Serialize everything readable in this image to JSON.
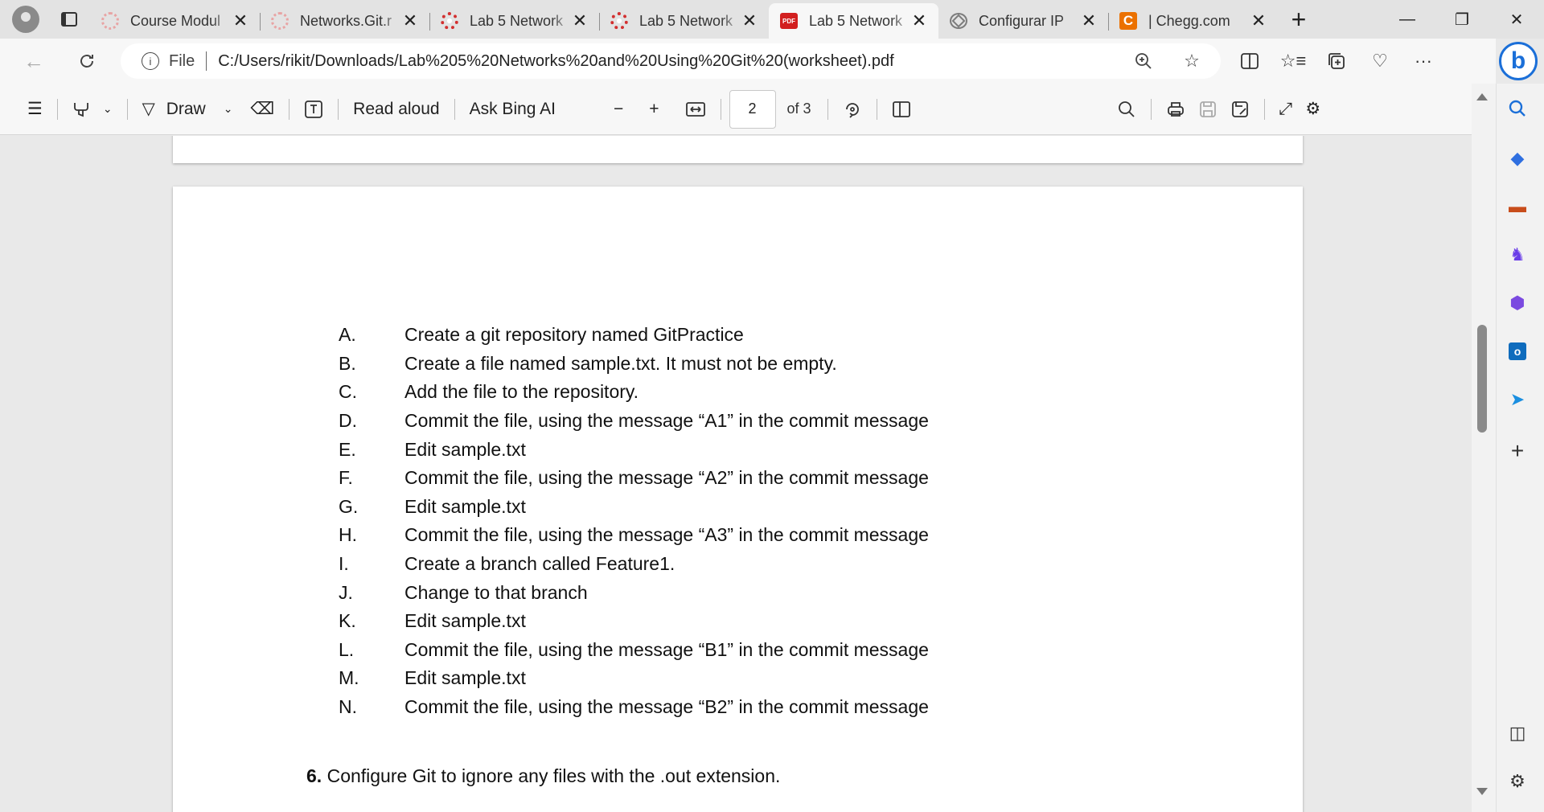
{
  "tabs": [
    {
      "title": "Course Modul",
      "favicon": "pale-logo-icon",
      "active": false
    },
    {
      "title": "Networks.Git.r",
      "favicon": "pale-logo-icon",
      "active": false
    },
    {
      "title": "Lab 5 Network",
      "favicon": "red-logo-icon",
      "active": false
    },
    {
      "title": "Lab 5 Network",
      "favicon": "red-logo-icon",
      "active": false
    },
    {
      "title": "Lab 5 Network",
      "favicon": "pdf-icon",
      "active": true
    },
    {
      "title": "Configurar IP",
      "favicon": "chatgpt-icon",
      "active": false
    },
    {
      "title": "| Chegg.com",
      "favicon": "chegg-icon",
      "active": false
    }
  ],
  "pdf_favicon_text": "PDF",
  "chegg_favicon_text": "C",
  "address": {
    "scheme_label": "File",
    "url": "C:/Users/rikit/Downloads/Lab%205%20Networks%20and%20Using%20Git%20(worksheet).pdf"
  },
  "pdf_toolbar": {
    "draw_label": "Draw",
    "read_aloud_label": "Read aloud",
    "ask_bing_label": "Ask Bing AI",
    "page_current": "2",
    "page_total_label": "of 3"
  },
  "document": {
    "steps": [
      {
        "letter": "A.",
        "text": "Create a git repository named GitPractice"
      },
      {
        "letter": "B.",
        "text": "Create a file named sample.txt.  It must not be empty."
      },
      {
        "letter": "C.",
        "text": "Add the file to the repository."
      },
      {
        "letter": "D.",
        "text": "Commit the file, using the message “A1” in the commit message"
      },
      {
        "letter": "E.",
        "text": "Edit sample.txt"
      },
      {
        "letter": "F.",
        "text": "Commit the file, using the message “A2” in the commit message"
      },
      {
        "letter": "G.",
        "text": "Edit sample.txt"
      },
      {
        "letter": "H.",
        "text": "Commit the file, using the message “A3” in the commit message"
      },
      {
        "letter": "I.",
        "text": "Create a branch called Feature1."
      },
      {
        "letter": "J.",
        "text": "Change to that branch"
      },
      {
        "letter": "K.",
        "text": "Edit sample.txt"
      },
      {
        "letter": "L.",
        "text": "Commit the file, using the message “B1” in the commit message"
      },
      {
        "letter": "M.",
        "text": "Edit sample.txt"
      },
      {
        "letter": "N.",
        "text": "Commit the file, using the message “B2” in the commit message"
      }
    ],
    "question6_number": "6.",
    "question6_text": " Configure Git to ignore any files with the .out extension."
  },
  "colors": {
    "accent": "#1b6fd8",
    "chegg": "#eb7100",
    "pdf": "#d21f1f"
  }
}
